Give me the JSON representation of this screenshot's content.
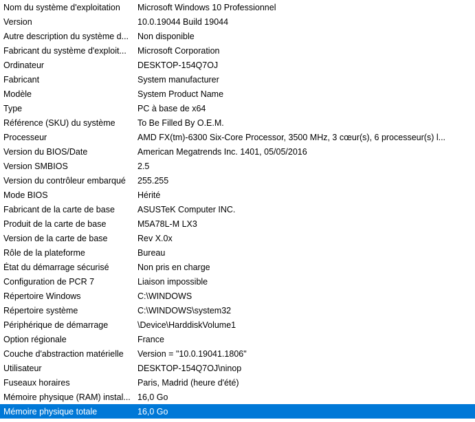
{
  "rows": [
    {
      "item": "Nom du système d'exploitation",
      "value": "Microsoft Windows 10 Professionnel"
    },
    {
      "item": "Version",
      "value": "10.0.19044 Build 19044"
    },
    {
      "item": "Autre description du système d...",
      "value": "Non disponible"
    },
    {
      "item": "Fabricant du système d'exploit...",
      "value": "Microsoft Corporation"
    },
    {
      "item": "Ordinateur",
      "value": "DESKTOP-154Q7OJ"
    },
    {
      "item": "Fabricant",
      "value": "System manufacturer"
    },
    {
      "item": "Modèle",
      "value": "System Product Name"
    },
    {
      "item": "Type",
      "value": "PC à base de x64"
    },
    {
      "item": "Référence (SKU) du système",
      "value": "To Be Filled By O.E.M."
    },
    {
      "item": "Processeur",
      "value": "AMD FX(tm)-6300 Six-Core Processor, 3500 MHz, 3 cœur(s), 6 processeur(s) l..."
    },
    {
      "item": "Version du BIOS/Date",
      "value": "American Megatrends Inc. 1401, 05/05/2016"
    },
    {
      "item": "Version SMBIOS",
      "value": "2.5"
    },
    {
      "item": "Version du contrôleur embarqué",
      "value": "255.255"
    },
    {
      "item": "Mode BIOS",
      "value": "Hérité"
    },
    {
      "item": "Fabricant de la carte de base",
      "value": "ASUSTeK Computer INC."
    },
    {
      "item": "Produit de la carte de base",
      "value": "M5A78L-M LX3"
    },
    {
      "item": "Version de la carte de base",
      "value": "Rev X.0x"
    },
    {
      "item": "Rôle de la plateforme",
      "value": "Bureau"
    },
    {
      "item": "État du démarrage sécurisé",
      "value": "Non pris en charge"
    },
    {
      "item": "Configuration de PCR 7",
      "value": "Liaison impossible"
    },
    {
      "item": "Répertoire Windows",
      "value": "C:\\WINDOWS"
    },
    {
      "item": "Répertoire système",
      "value": "C:\\WINDOWS\\system32"
    },
    {
      "item": "Périphérique de démarrage",
      "value": "\\Device\\HarddiskVolume1"
    },
    {
      "item": "Option régionale",
      "value": "France"
    },
    {
      "item": "Couche d'abstraction matérielle",
      "value": "Version = \"10.0.19041.1806\""
    },
    {
      "item": "Utilisateur",
      "value": "DESKTOP-154Q7OJ\\ninop"
    },
    {
      "item": "Fuseaux horaires",
      "value": "Paris, Madrid (heure d'été)"
    },
    {
      "item": "Mémoire physique (RAM) instal...",
      "value": "16,0 Go"
    },
    {
      "item": "Mémoire physique totale",
      "value": "16,0 Go"
    }
  ],
  "selected_index": 28,
  "colors": {
    "selection_background": "#0078d7",
    "selection_text": "#ffffff"
  }
}
